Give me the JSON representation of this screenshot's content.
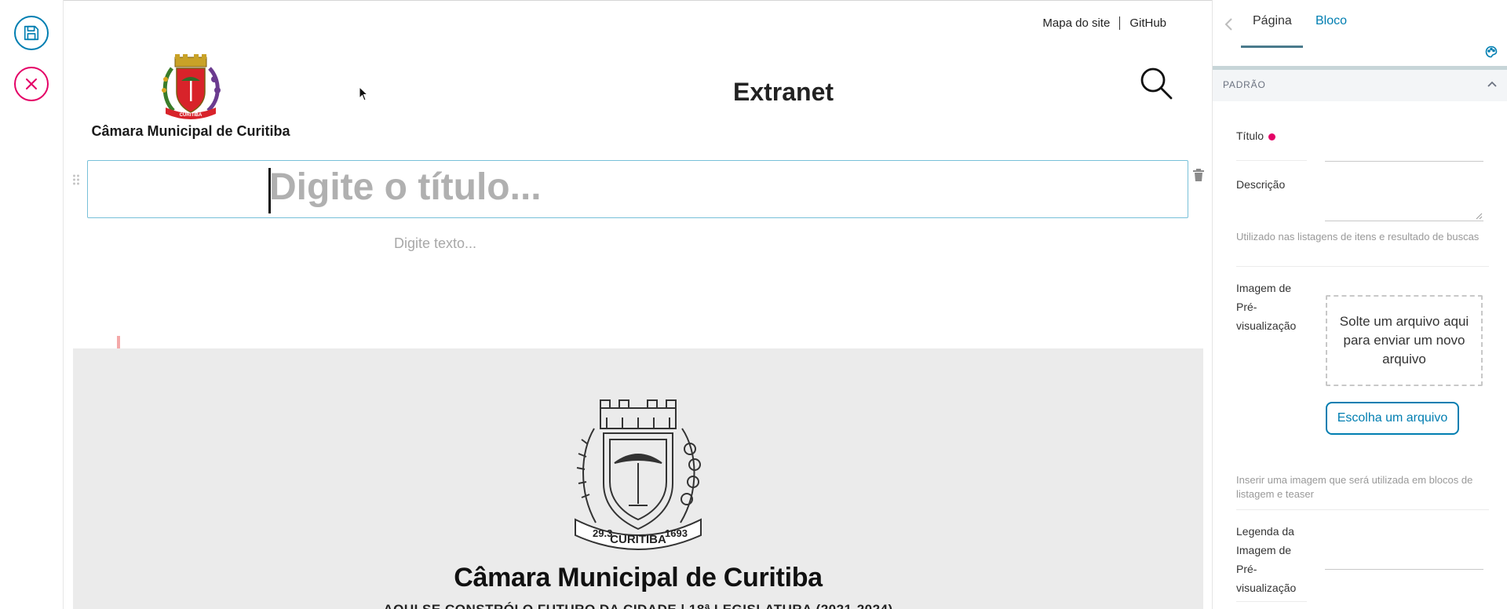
{
  "toolbar": {
    "save_icon": "floppy-disk-icon",
    "cancel_icon": "close-icon",
    "save_color": "#007eb1",
    "cancel_color": "#e40166"
  },
  "header": {
    "links": [
      "Mapa do site",
      "GitHub"
    ],
    "site_title": "Extranet",
    "logo_name": "Câmara Municipal de Curitiba",
    "search_icon": "search-icon"
  },
  "editor": {
    "title_placeholder": "Digite o título...",
    "text_placeholder": "Digite texto..."
  },
  "banner": {
    "seal_text": "CURITIBA",
    "seal_left": "29.3",
    "seal_right": "1693",
    "name": "Câmara Municipal de Curitiba",
    "tagline": "AQUI SE CONSTRÓI O FUTURO DA CIDADE | 18ª LEGISLATURA (2021-2024)"
  },
  "sidebar": {
    "tabs": [
      "Página",
      "Bloco"
    ],
    "active_tab": "Página",
    "section_label": "PADRÃO",
    "fields": {
      "titulo_label": "Título",
      "descricao_label": "Descrição",
      "descricao_help": "Utilizado nas listagens de itens e resultado de buscas",
      "imagem_label": "Imagem de Pré-visualização",
      "dropzone_text": "Solte um arquivo aqui para enviar um novo arquivo",
      "choose_button": "Escolha um arquivo",
      "imagem_help": "Inserir uma imagem que será utilizada em blocos de listagem e teaser",
      "legenda_label": "Legenda da Imagem de Pré-visualização"
    }
  }
}
